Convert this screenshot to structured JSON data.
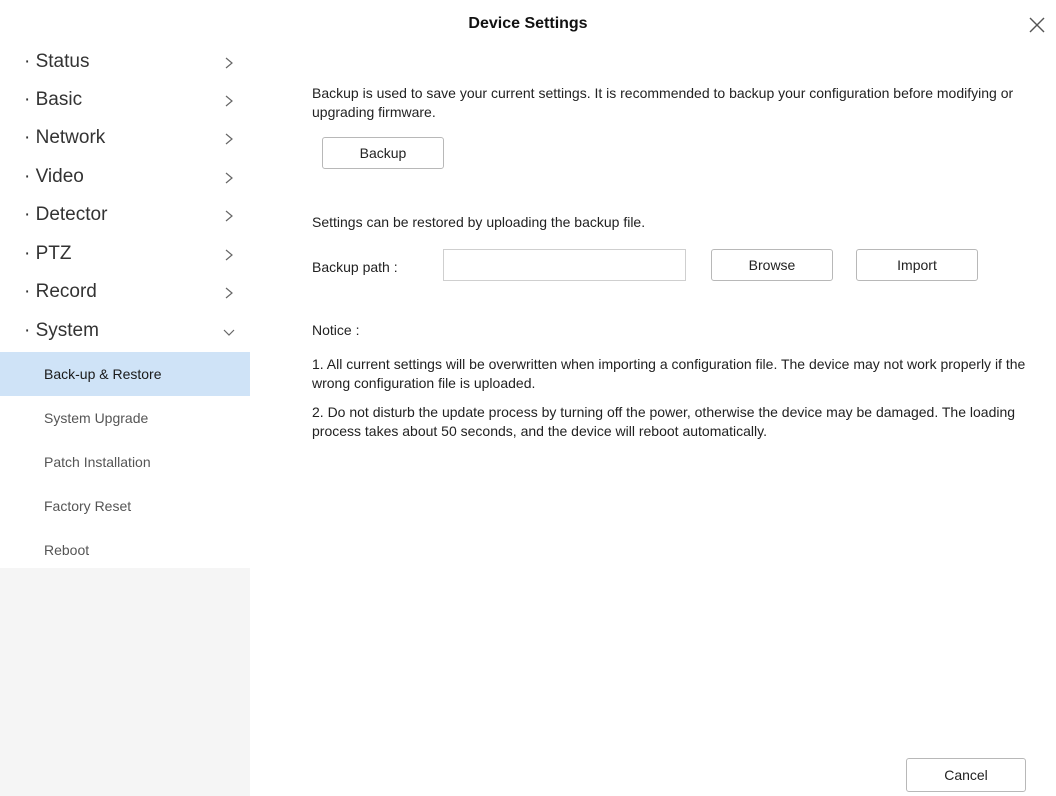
{
  "window": {
    "title": "Device Settings",
    "close_icon": "close-icon"
  },
  "sidebar": {
    "items": [
      {
        "label": "· Status",
        "icon": "chevron-right-icon"
      },
      {
        "label": "· Basic",
        "icon": "chevron-right-icon"
      },
      {
        "label": "· Network",
        "icon": "chevron-right-icon"
      },
      {
        "label": "· Video",
        "icon": "chevron-right-icon"
      },
      {
        "label": "· Detector",
        "icon": "chevron-right-icon"
      },
      {
        "label": "· PTZ",
        "icon": "chevron-right-icon"
      },
      {
        "label": "· Record",
        "icon": "chevron-right-icon"
      },
      {
        "label": "· System",
        "icon": "chevron-down-icon",
        "expanded": true
      }
    ],
    "subitems": [
      {
        "label": "Back-up & Restore",
        "active": true
      },
      {
        "label": "System Upgrade"
      },
      {
        "label": "Patch Installation"
      },
      {
        "label": "Factory Reset"
      },
      {
        "label": "Reboot"
      }
    ],
    "active_color": "#cfe3f7"
  },
  "main": {
    "backup_description": "Backup is used to save your current settings. It is recommended to backup your configuration before modifying or upgrading firmware.",
    "backup_button": "Backup",
    "restore_description": "Settings can be restored by uploading the backup file.",
    "backup_path_label": "Backup path :",
    "backup_path_value": "",
    "browse_button": "Browse",
    "import_button": "Import",
    "notice_title": "Notice :",
    "notice_1": "1. All current settings will be overwritten when importing a configuration file. The device may not work properly if the wrong configuration file is uploaded.",
    "notice_2": "2. Do not disturb the update process by turning off the power, otherwise the device may be damaged. The loading process takes about 50 seconds, and the device will reboot automatically.",
    "cancel_button": "Cancel"
  }
}
